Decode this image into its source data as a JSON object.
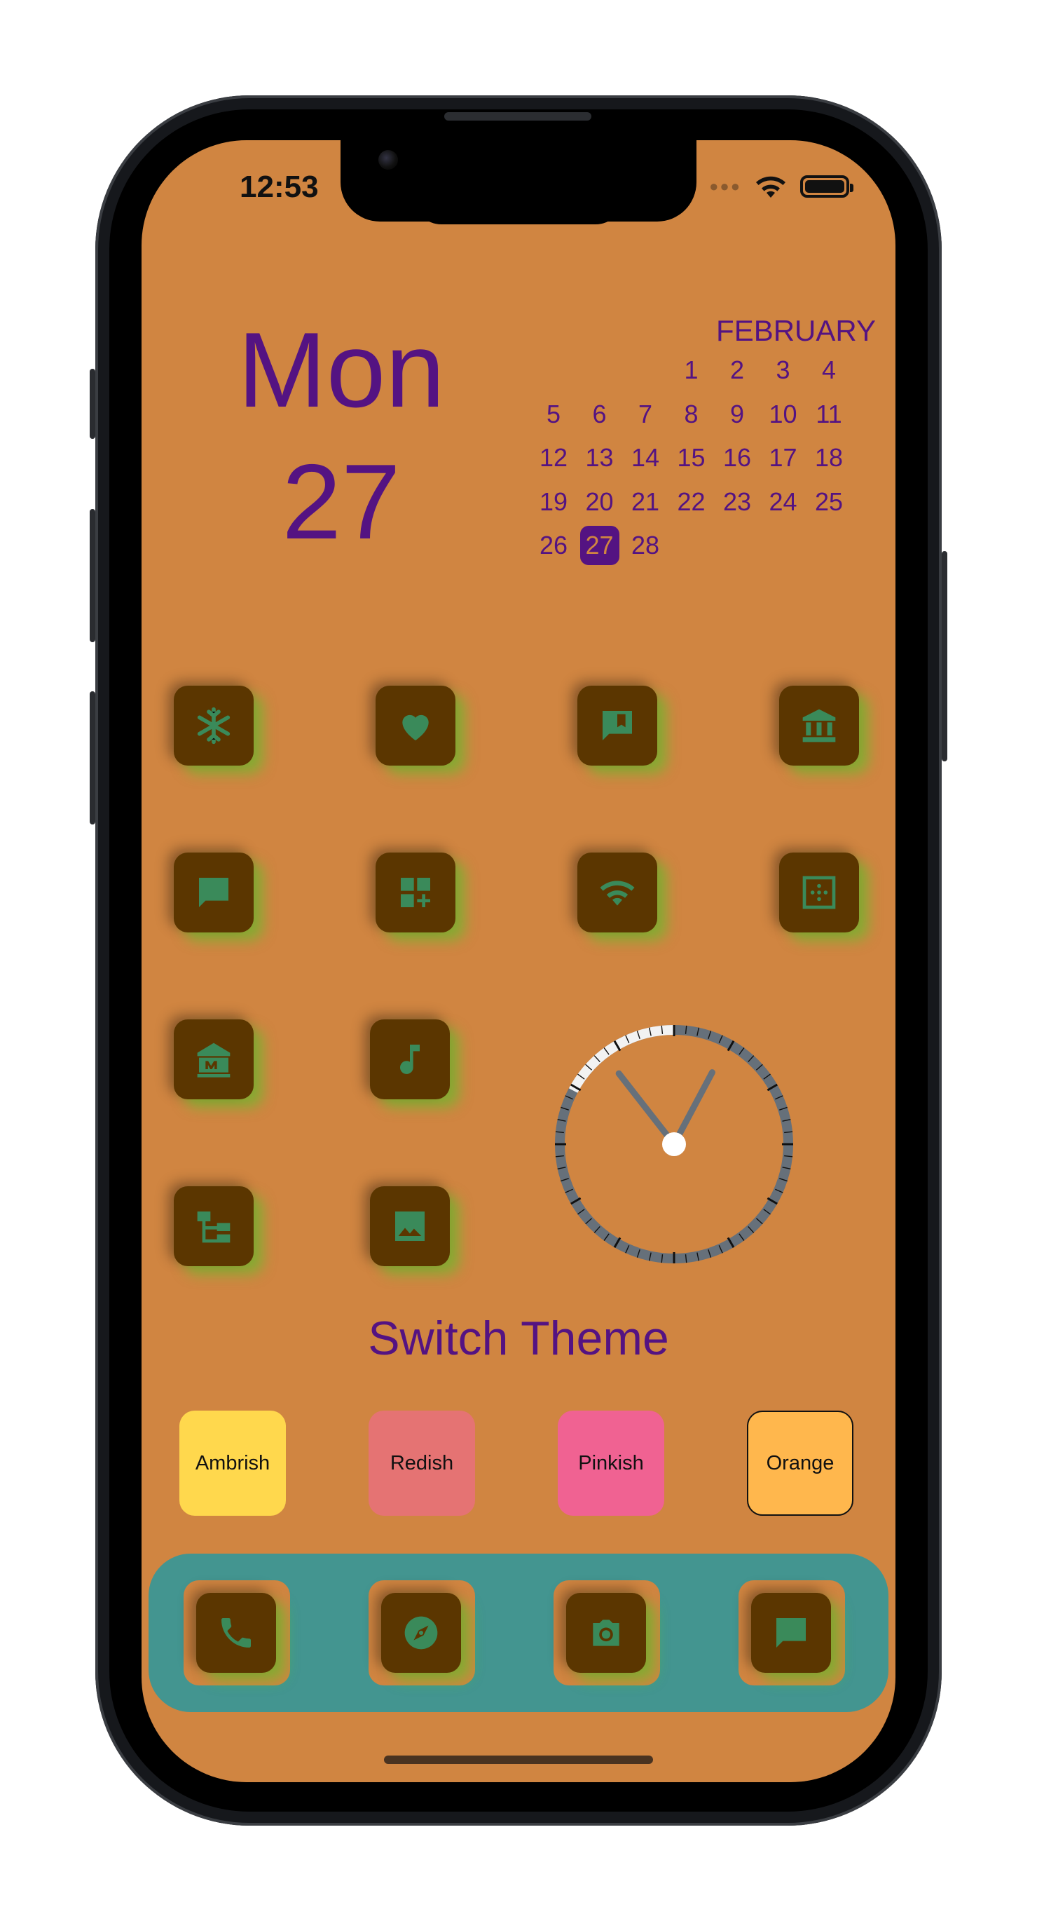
{
  "status_bar": {
    "time": "12:53"
  },
  "widget": {
    "day_name": "Mon",
    "day_number": "27",
    "calendar": {
      "month": "FEBRUARY",
      "weeks": [
        [
          "",
          "",
          "",
          "1",
          "2",
          "3",
          "4"
        ],
        [
          "5",
          "6",
          "7",
          "8",
          "9",
          "10",
          "11"
        ],
        [
          "12",
          "13",
          "14",
          "15",
          "16",
          "17",
          "18"
        ],
        [
          "19",
          "20",
          "21",
          "22",
          "23",
          "24",
          "25"
        ],
        [
          "26",
          "27",
          "28",
          "",
          "",
          "",
          ""
        ]
      ],
      "selected": "27"
    }
  },
  "apps": [
    {
      "icon": "snowflake-icon"
    },
    {
      "icon": "heart-icon"
    },
    {
      "icon": "bookmark-chat-icon"
    },
    {
      "icon": "bank-icon"
    },
    {
      "icon": "chat-icon"
    },
    {
      "icon": "add-widget-icon"
    },
    {
      "icon": "wifi-icon"
    },
    {
      "icon": "crop-dotted-icon"
    },
    {
      "icon": "museum-icon"
    },
    {
      "icon": "music-note-icon"
    },
    {
      "icon": "account-tree-icon"
    },
    {
      "icon": "image-icon"
    }
  ],
  "clock": {
    "hour_hand_deg": -38,
    "minute_hand_deg": 28
  },
  "switch_theme": {
    "title": "Switch Theme",
    "options": [
      {
        "label": "Ambrish",
        "color": "#ffd84d"
      },
      {
        "label": "Redish",
        "color": "#e57373"
      },
      {
        "label": "Pinkish",
        "color": "#f06292"
      },
      {
        "label": "Orange",
        "color": "#ffb74d"
      }
    ],
    "selected": "Orange"
  },
  "dock": [
    {
      "icon": "phone-icon"
    },
    {
      "icon": "compass-icon"
    },
    {
      "icon": "camera-icon"
    },
    {
      "icon": "chat-icon"
    }
  ],
  "colors": {
    "background": "#d08541",
    "accent_text": "#541382",
    "app_tile": "#5b3600",
    "icon_green": "#3a8a5a",
    "dock": "#439590"
  }
}
